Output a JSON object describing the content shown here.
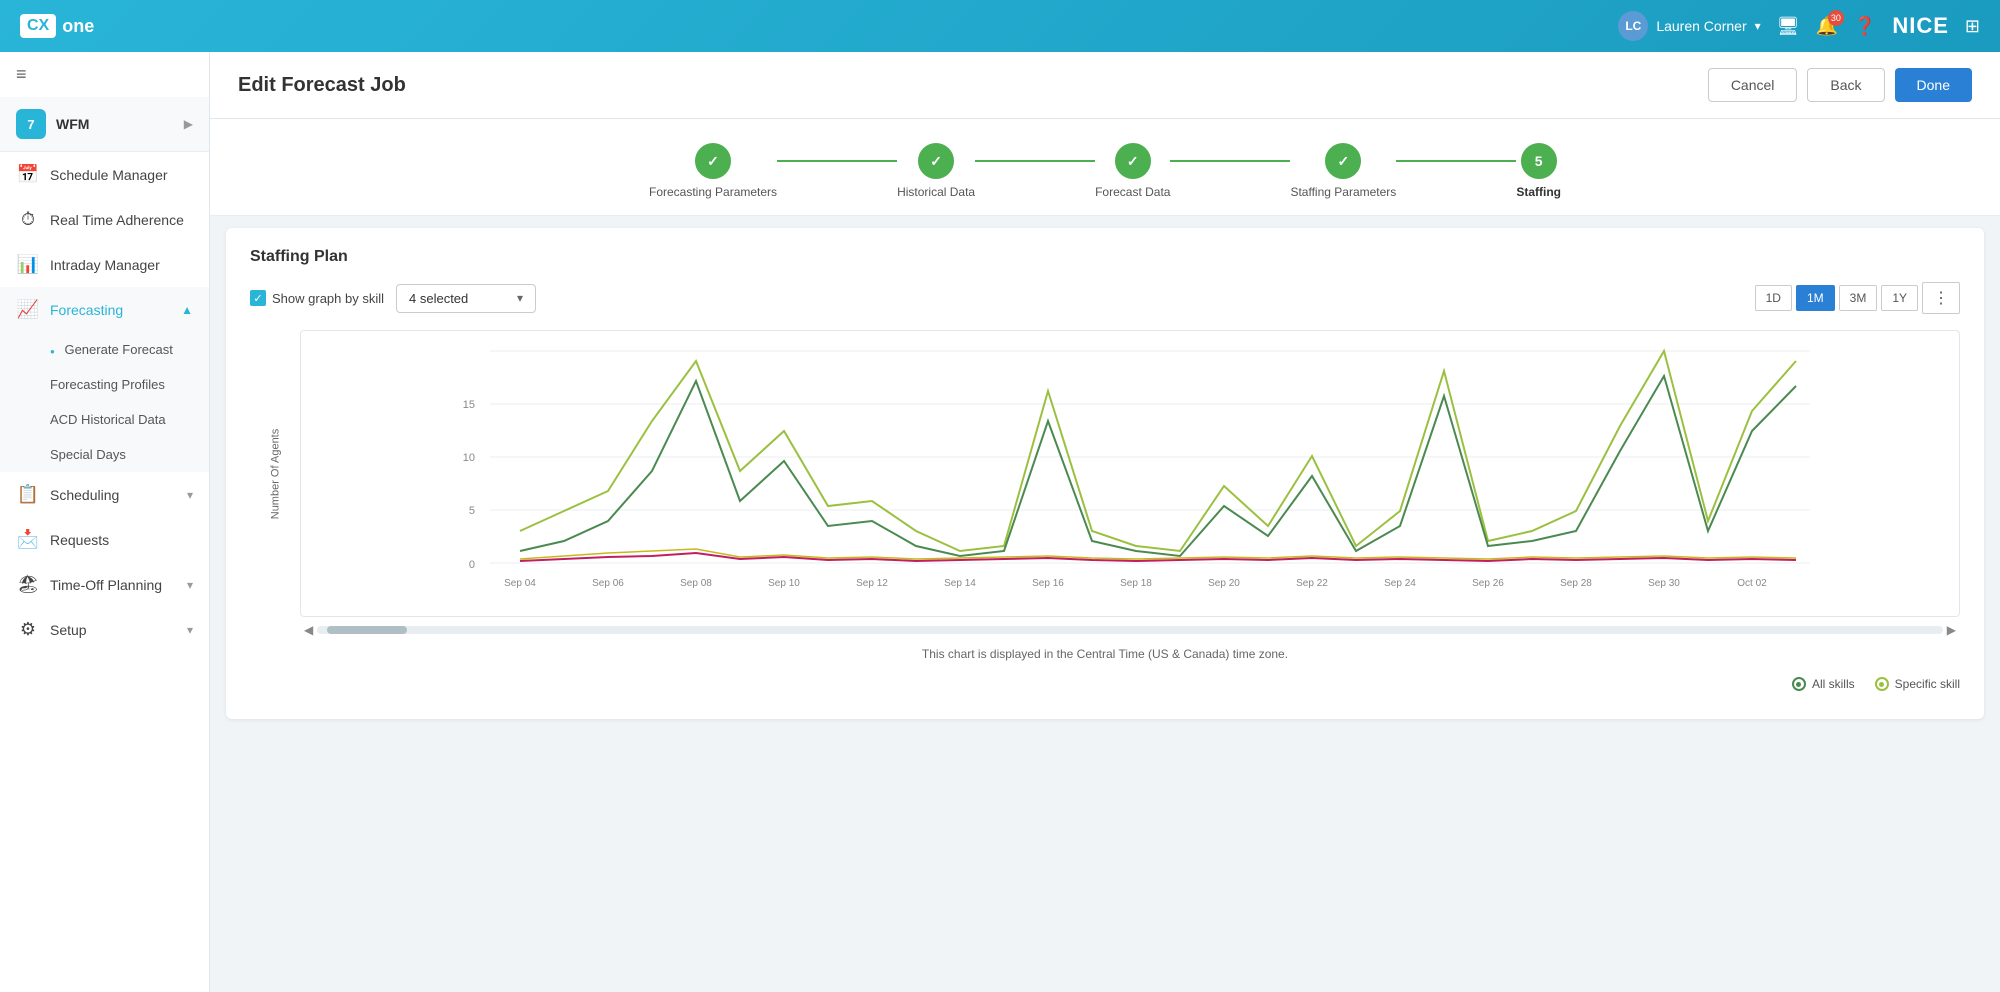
{
  "header": {
    "logo_cx": "CX",
    "logo_one": "one",
    "user_initials": "LC",
    "user_name": "Lauren Corner",
    "notification_count": "30",
    "nice_logo": "NICE",
    "grid_icon": "⊞"
  },
  "page": {
    "title": "Edit Forecast Job",
    "btn_cancel": "Cancel",
    "btn_back": "Back",
    "btn_done": "Done"
  },
  "stepper": {
    "steps": [
      {
        "label": "Forecasting Parameters",
        "state": "completed",
        "symbol": "✓"
      },
      {
        "label": "Historical Data",
        "state": "completed",
        "symbol": "✓"
      },
      {
        "label": "Forecast Data",
        "state": "completed",
        "symbol": "✓"
      },
      {
        "label": "Staffing Parameters",
        "state": "completed",
        "symbol": "✓"
      },
      {
        "label": "Staffing",
        "state": "active",
        "symbol": "5"
      }
    ]
  },
  "sidebar": {
    "wfm_label": "WFM",
    "wfm_badge": "7",
    "items": [
      {
        "label": "Schedule Manager",
        "icon": "📅"
      },
      {
        "label": "Real Time Adherence",
        "icon": "⏱"
      },
      {
        "label": "Intraday Manager",
        "icon": "📊"
      },
      {
        "label": "Forecasting",
        "icon": "📈",
        "active": true,
        "expanded": true
      },
      {
        "label": "Scheduling",
        "icon": "📋"
      },
      {
        "label": "Requests",
        "icon": "📩"
      },
      {
        "label": "Time-Off Planning",
        "icon": "🏖"
      },
      {
        "label": "Setup",
        "icon": "⚙"
      }
    ],
    "forecasting_sub": [
      {
        "label": "Generate Forecast",
        "active": true
      },
      {
        "label": "Forecasting Profiles"
      },
      {
        "label": "ACD Historical Data"
      },
      {
        "label": "Special Days"
      }
    ]
  },
  "staffing_plan": {
    "title": "Staffing Plan",
    "show_graph_label": "Show graph by skill",
    "dropdown_value": "4 selected",
    "time_buttons": [
      "1D",
      "1M",
      "3M",
      "1Y"
    ],
    "active_time": "1M",
    "x_labels": [
      "Sep 04",
      "Sep 06",
      "Sep 08",
      "Sep 10",
      "Sep 12",
      "Sep 14",
      "Sep 16",
      "Sep 18",
      "Sep 20",
      "Sep 22",
      "Sep 24",
      "Sep 26",
      "Sep 28",
      "Sep 30",
      "Oct 02"
    ],
    "y_labels": [
      "0",
      "5",
      "10",
      "15"
    ],
    "y_axis_label": "Number Of Agents",
    "timezone_note": "This chart is displayed in the Central Time (US & Canada) time zone.",
    "legend": [
      {
        "label": "All skills",
        "color": "#6dc36d"
      },
      {
        "label": "Specific skill",
        "color": "#a8c840"
      }
    ]
  }
}
